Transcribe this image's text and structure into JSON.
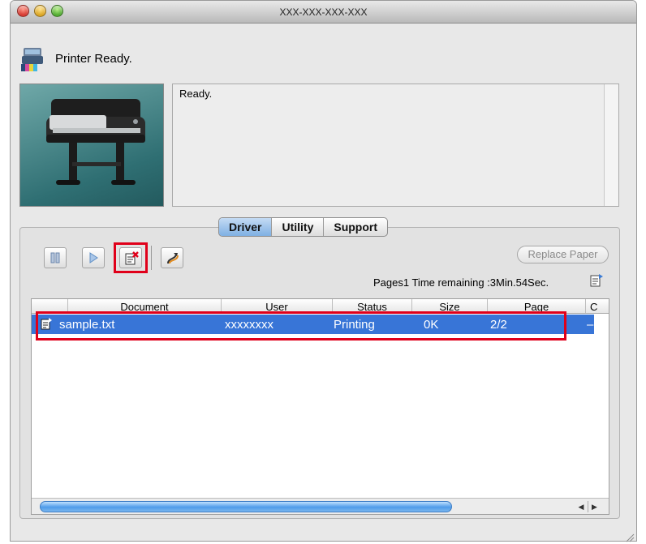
{
  "window": {
    "title": "XXX-XXX-XXX-XXX"
  },
  "status": {
    "text": "Printer Ready.",
    "icon": "printer-status-icon"
  },
  "message": {
    "text": "Ready."
  },
  "tabs": [
    {
      "label": "Driver",
      "active": true
    },
    {
      "label": "Utility",
      "active": false
    },
    {
      "label": "Support",
      "active": false
    }
  ],
  "toolbar": {
    "pause_icon": "pause-icon",
    "resume_icon": "play-icon",
    "delete_icon": "delete-job-icon",
    "priority_icon": "priority-print-icon",
    "replace_paper_label": "Replace Paper"
  },
  "pages_info": "Pages1 Time remaining :3Min.54Sec.",
  "table": {
    "columns": [
      "Document",
      "User",
      "Status",
      "Size",
      "Page",
      "C"
    ],
    "rows": [
      {
        "document": "sample.txt",
        "user": "xxxxxxxx",
        "status": "Printing",
        "size": "0K",
        "page": "2/2",
        "extra": "–",
        "selected": true
      }
    ]
  },
  "colors": {
    "selection": "#3875d7",
    "highlight": "#e0001a",
    "active_tab": "#7fb0e3"
  }
}
